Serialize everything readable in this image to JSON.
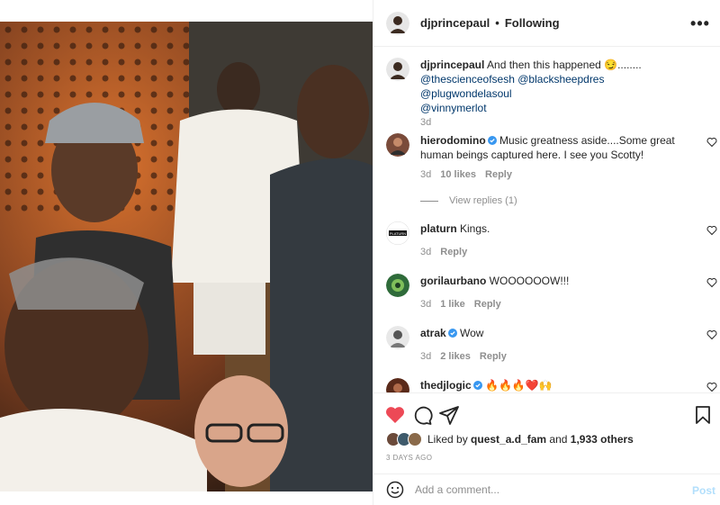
{
  "post": {
    "author": "djprincepaul",
    "dot": "•",
    "follow_status": "Following",
    "more_label": "•••",
    "caption": {
      "username": "djprincepaul",
      "text": " And then this happened 😏........ ",
      "mentions": [
        "@thescienceofsesh",
        "@blacksheepdres",
        "@plugwondelasoul",
        "@vinnymerlot"
      ],
      "time": "3d"
    }
  },
  "comments": [
    {
      "username": "hierodomino",
      "verified": true,
      "text": " Music greatness aside....Some great human beings captured here. I see you Scotty!",
      "time": "3d",
      "likes": "10 likes",
      "reply": "Reply",
      "view_replies": "View replies (1)"
    },
    {
      "username": "platurn",
      "verified": false,
      "text": " Kings.",
      "time": "3d",
      "likes": "",
      "reply": "Reply",
      "avatar_text": "PLATURN"
    },
    {
      "username": "gorilaurbano",
      "verified": false,
      "text": " WOOOOOOW!!!",
      "time": "3d",
      "likes": "1 like",
      "reply": "Reply"
    },
    {
      "username": "atrak",
      "verified": true,
      "text": " Wow",
      "time": "3d",
      "likes": "2 likes",
      "reply": "Reply"
    },
    {
      "username": "thedjlogic",
      "verified": true,
      "text": " 🔥🔥🔥❤️🙌",
      "time": "",
      "likes": "",
      "reply": ""
    }
  ],
  "likes_summary": {
    "prefix": "Liked by ",
    "user": "quest_a.d_fam",
    "middle": " and ",
    "count": "1,933 others"
  },
  "date_ago": "3 DAYS AGO",
  "add_comment": {
    "placeholder": "Add a comment...",
    "post_label": "Post"
  },
  "icons": {
    "like": "heart-filled-icon",
    "comment": "comment-icon",
    "share": "share-icon",
    "save": "bookmark-icon",
    "emoji": "emoji-icon",
    "more": "more-icon"
  },
  "colors": {
    "like_red": "#ed4956",
    "verified_blue": "#3897f0",
    "mention_blue": "#00376b",
    "post_disabled": "#b2dffc"
  }
}
